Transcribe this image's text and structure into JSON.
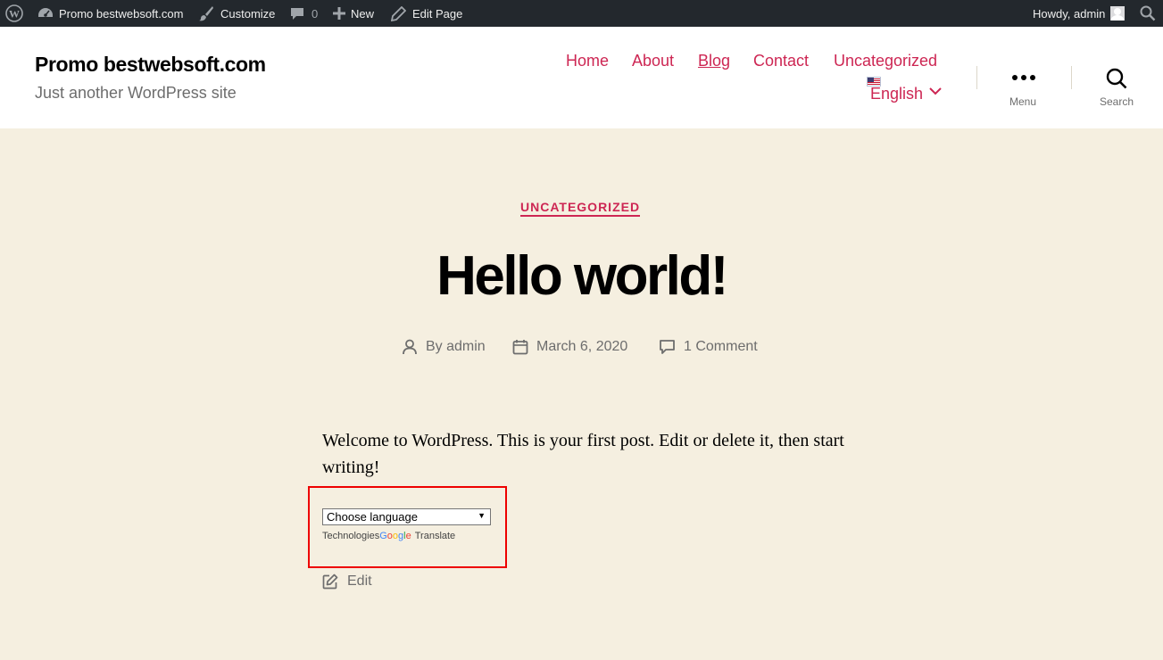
{
  "admin_bar": {
    "site_name": "Promo bestwebsoft.com",
    "customize": "Customize",
    "comments_count": "0",
    "new": "New",
    "edit_page": "Edit Page",
    "howdy": "Howdy, admin"
  },
  "header": {
    "site_title": "Promo bestwebsoft.com",
    "site_description": "Just another WordPress site",
    "nav": [
      "Home",
      "About",
      "Blog",
      "Contact",
      "Uncategorized"
    ],
    "language": "English",
    "menu_label": "Menu",
    "search_label": "Search"
  },
  "post": {
    "category": "UNCATEGORIZED",
    "title": "Hello world!",
    "author": "By admin",
    "date": "March 6, 2020",
    "comments": "1 Comment",
    "content": "Welcome to WordPress. This is your first post. Edit or delete it, then start writing!",
    "edit_label": "Edit"
  },
  "translate_widget": {
    "select_value": "Choose language",
    "powered_prefix": "Technologies",
    "google_letters": [
      "G",
      "o",
      "o",
      "g",
      "l",
      "e"
    ],
    "translate_label": "Translate"
  },
  "colors": {
    "accent": "#cd2653",
    "admin_bar_bg": "#23282d",
    "page_bg": "#f5efe0",
    "highlight_border": "#ee0000"
  }
}
